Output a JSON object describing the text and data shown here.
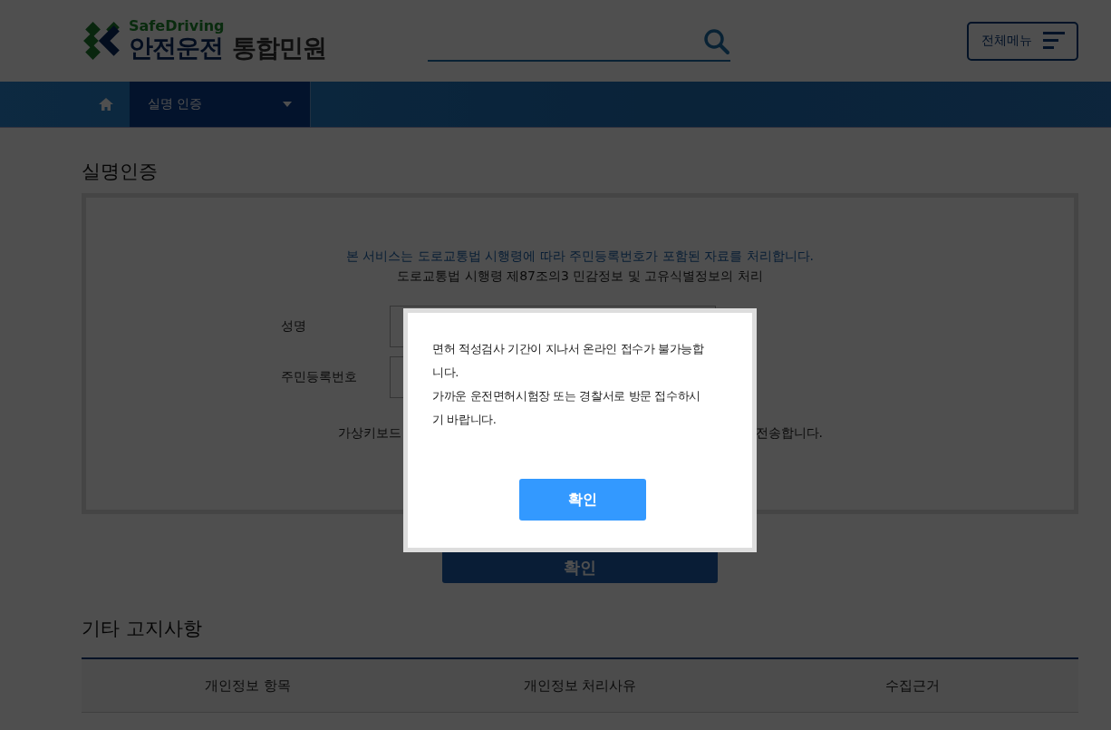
{
  "header": {
    "logo_tagline": "SafeDriving",
    "logo_title": "안전운전",
    "logo_subtitle": "통합민원",
    "menu_button": "전체메뉴"
  },
  "nav": {
    "current": "실명 인증"
  },
  "page_title": "실명인증",
  "notice": {
    "line_1": "본 서비스는 도로교통법 시행령에 따라 주민등록번호가 포함된 자료를 처리합니다.",
    "line_2": "도로교통법 시행령 제87조의3 민감정보 및 고유식별정보의 처리"
  },
  "form": {
    "fields": [
      {
        "label": "성명"
      },
      {
        "label": "주민등록번호"
      }
    ],
    "keyboard_note_start": "가상키보드",
    "keyboard_note_end": "전송합니다.",
    "submit": "확인"
  },
  "section_title": "기타 고지사항",
  "table": {
    "columns": [
      "개인정보 항목",
      "개인정보 처리사유",
      "수집근거"
    ]
  },
  "dialog": {
    "message_lines": [
      "면허 적성검사 기간이 지나서 온라인 접수가 불가능합",
      "니다.",
      "가까운 운전면허시험장 또는 경찰서로 방문 접수하시",
      "기 바랍니다."
    ],
    "button": "확인"
  }
}
